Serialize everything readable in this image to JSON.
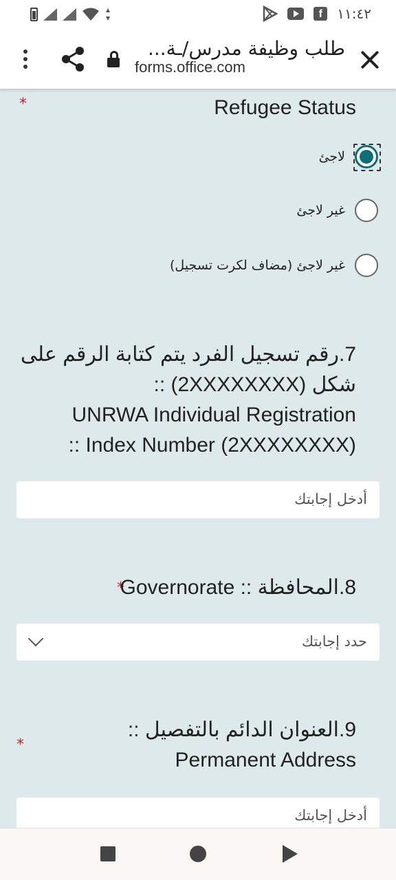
{
  "status_bar": {
    "time": "١١:٤٢",
    "left_icons": [
      "battery-icon",
      "signal-icon",
      "signal-icon",
      "wifi-icon"
    ],
    "right_icons": [
      "play-store-icon",
      "youtube-icon",
      "facebook-icon"
    ]
  },
  "browser": {
    "title": "طلب وظيفة مدرس/ـة...",
    "url": "forms.office.com",
    "menu_icon": "more-vert-icon",
    "share_icon": "share-icon",
    "lock_icon": "lock-icon",
    "close_icon": "close-icon"
  },
  "form": {
    "accent_color": "#0d6f73",
    "required_mark": "*",
    "q6": {
      "title": "Refugee Status",
      "options": [
        "لاجئ",
        "غير لاجئ",
        "غير لاجئ (مضاف لكرت تسجيل)"
      ],
      "selected_index": 0
    },
    "q7": {
      "line1": "7.رقم تسجيل الفرد  يتم كتابة الرقم على",
      "line2": "شكل (2XXXXXXXX) ::",
      "line3": "UNRWA Individual  Registration",
      "line4": ":: Index Number (2XXXXXXXX)",
      "placeholder": "أدخل إجابتك"
    },
    "q8": {
      "title": "8.المحافظة :: Governorate",
      "placeholder": "حدد إجابتك"
    },
    "q9": {
      "line1": "9.العنوان الدائم بالتفصيل ::",
      "line2": "Permanent Address",
      "placeholder": "أدخل إجابتك"
    }
  },
  "nav_bar": {
    "icons": [
      "recents-icon",
      "home-icon",
      "back-icon"
    ]
  }
}
